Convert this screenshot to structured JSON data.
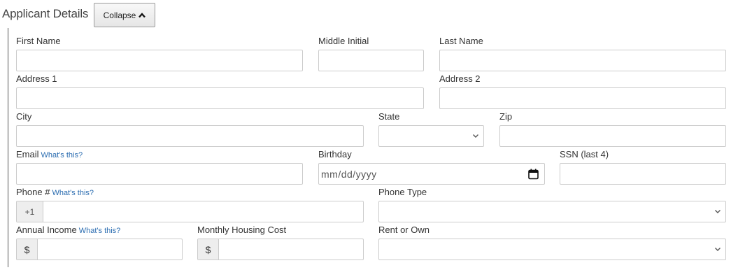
{
  "section": {
    "title": "Applicant Details",
    "collapse_label": "Collapse"
  },
  "fields": {
    "first_name": {
      "label": "First Name",
      "value": ""
    },
    "middle_initial": {
      "label": "Middle Initial",
      "value": ""
    },
    "last_name": {
      "label": "Last Name",
      "value": ""
    },
    "address1": {
      "label": "Address 1",
      "value": ""
    },
    "address2": {
      "label": "Address 2",
      "value": ""
    },
    "city": {
      "label": "City",
      "value": ""
    },
    "state": {
      "label": "State",
      "value": ""
    },
    "zip": {
      "label": "Zip",
      "value": ""
    },
    "email": {
      "label": "Email",
      "help": "What's this?",
      "value": ""
    },
    "birthday": {
      "label": "Birthday",
      "placeholder": "mm/dd/yyyy"
    },
    "ssn": {
      "label": "SSN (last 4)",
      "value": ""
    },
    "phone": {
      "label": "Phone #",
      "help": "What's this?",
      "prefix": "+1",
      "value": ""
    },
    "phone_type": {
      "label": "Phone Type",
      "value": ""
    },
    "annual_income": {
      "label": "Annual Income",
      "help": "What's this?",
      "prefix": "$",
      "value": ""
    },
    "monthly_housing": {
      "label": "Monthly Housing Cost",
      "prefix": "$",
      "value": ""
    },
    "rent_or_own": {
      "label": "Rent or Own",
      "value": ""
    }
  },
  "icons": {
    "collapse": "chevron-up-icon",
    "select": "chevron-down-icon",
    "calendar": "calendar-icon"
  },
  "colors": {
    "help_link": "#2a6cb0",
    "border": "#cccccc",
    "addon_bg": "#eeeeee"
  }
}
